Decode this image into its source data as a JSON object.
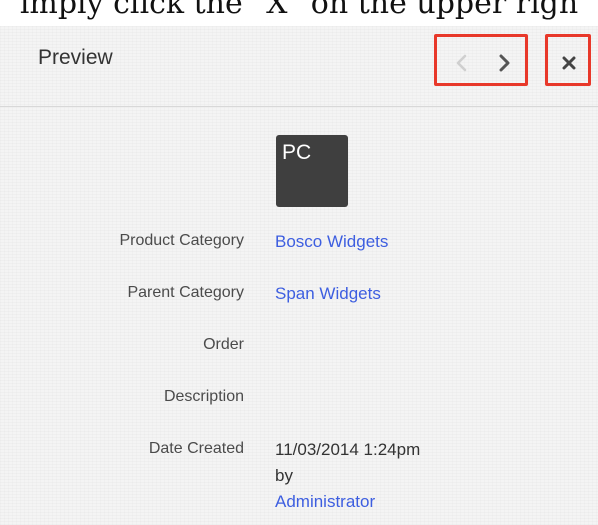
{
  "top_text": "imply click the \"X\" on the upper righ",
  "header": {
    "title": "Preview"
  },
  "icons": {
    "prev": "chevron-left-icon",
    "next": "chevron-right-icon",
    "close": "close-icon"
  },
  "colors": {
    "highlight": "#e8382a",
    "link": "#3d5ee0",
    "avatar_bg": "#3f3f3f"
  },
  "avatar": {
    "initials": "PC"
  },
  "fields": {
    "product_category": {
      "label": "Product Category",
      "value": "Bosco Widgets"
    },
    "parent_category": {
      "label": "Parent Category",
      "value": "Span Widgets"
    },
    "order": {
      "label": "Order",
      "value": ""
    },
    "description": {
      "label": "Description",
      "value": ""
    },
    "date_created": {
      "label": "Date Created",
      "value": "11/03/2014 1:24pm",
      "by": "by",
      "user": "Administrator"
    }
  }
}
